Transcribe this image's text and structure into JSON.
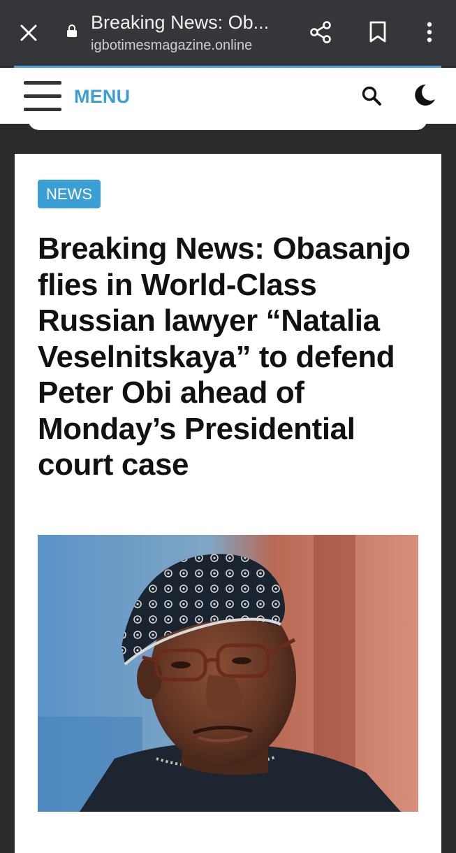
{
  "browser": {
    "page_title": "Breaking News: Ob...",
    "url": "igbotimesmagazine.online",
    "icons": [
      "close-icon",
      "lock-icon",
      "share-icon",
      "bookmark-icon",
      "more-vert-icon"
    ]
  },
  "header": {
    "menu_label": "MENU",
    "icons": [
      "hamburger-icon",
      "search-icon",
      "dark-mode-icon"
    ],
    "accent_color": "#3a9fd4"
  },
  "article": {
    "category": "NEWS",
    "headline": "Breaking News: Obasanjo flies in World-Class Russian lawyer “Natalia Veselnitskaya” to defend Peter Obi ahead of Monday’s Presidential court case"
  }
}
